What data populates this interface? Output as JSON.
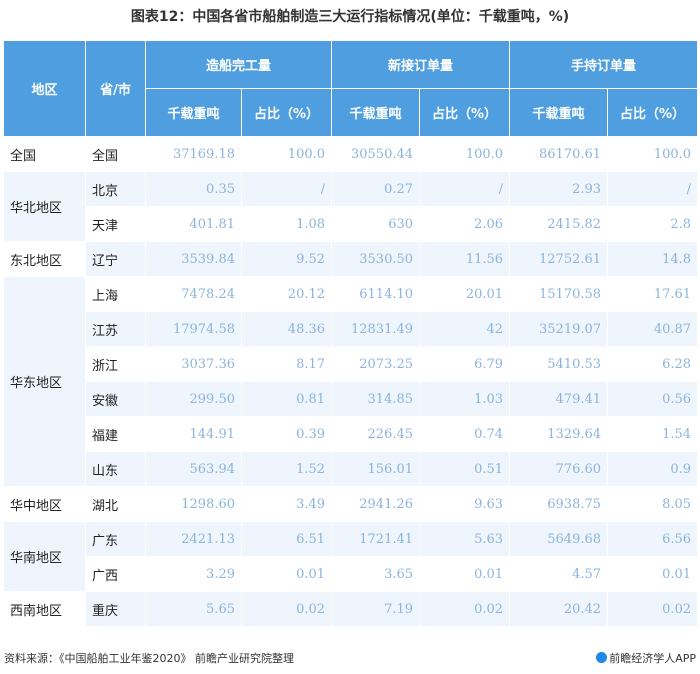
{
  "title": "图表12：中国各省市船舶制造三大运行指标情况(单位：千载重吨，%)",
  "headers": {
    "region": "地区",
    "province": "省/市",
    "groups": [
      "造船完工量",
      "新接订单量",
      "手持订单量"
    ],
    "sub": [
      "千载重吨",
      "占比（%）",
      "千载重吨",
      "占比（%）",
      "千载重吨",
      "占比（%）"
    ]
  },
  "regions": [
    {
      "name": "全国",
      "rows": [
        {
          "prov": "全国",
          "v": [
            "37169.18",
            "100.0",
            "30550.44",
            "100.0",
            "86170.61",
            "100.0"
          ]
        }
      ]
    },
    {
      "name": "华北地区",
      "rows": [
        {
          "prov": "北京",
          "v": [
            "0.35",
            "/",
            "0.27",
            "/",
            "2.93",
            "/"
          ]
        },
        {
          "prov": "天津",
          "v": [
            "401.81",
            "1.08",
            "630",
            "2.06",
            "2415.82",
            "2.8"
          ]
        }
      ]
    },
    {
      "name": "东北地区",
      "rows": [
        {
          "prov": "辽宁",
          "v": [
            "3539.84",
            "9.52",
            "3530.50",
            "11.56",
            "12752.61",
            "14.8"
          ]
        }
      ]
    },
    {
      "name": "华东地区",
      "rows": [
        {
          "prov": "上海",
          "v": [
            "7478.24",
            "20.12",
            "6114.10",
            "20.01",
            "15170.58",
            "17.61"
          ]
        },
        {
          "prov": "江苏",
          "v": [
            "17974.58",
            "48.36",
            "12831.49",
            "42",
            "35219.07",
            "40.87"
          ]
        },
        {
          "prov": "浙江",
          "v": [
            "3037.36",
            "8.17",
            "2073.25",
            "6.79",
            "5410.53",
            "6.28"
          ]
        },
        {
          "prov": "安徽",
          "v": [
            "299.50",
            "0.81",
            "314.85",
            "1.03",
            "479.41",
            "0.56"
          ]
        },
        {
          "prov": "福建",
          "v": [
            "144.91",
            "0.39",
            "226.45",
            "0.74",
            "1329.64",
            "1.54"
          ]
        },
        {
          "prov": "山东",
          "v": [
            "563.94",
            "1.52",
            "156.01",
            "0.51",
            "776.60",
            "0.9"
          ]
        }
      ]
    },
    {
      "name": "华中地区",
      "rows": [
        {
          "prov": "湖北",
          "v": [
            "1298.60",
            "3.49",
            "2941.26",
            "9.63",
            "6938.75",
            "8.05"
          ]
        }
      ]
    },
    {
      "name": "华南地区",
      "rows": [
        {
          "prov": "广东",
          "v": [
            "2421.13",
            "6.51",
            "1721.41",
            "5.63",
            "5649.68",
            "6.56"
          ]
        },
        {
          "prov": "广西",
          "v": [
            "3.29",
            "0.01",
            "3.65",
            "0.01",
            "4.57",
            "0.01"
          ]
        }
      ]
    },
    {
      "name": "西南地区",
      "rows": [
        {
          "prov": "重庆",
          "v": [
            "5.65",
            "0.02",
            "7.19",
            "0.02",
            "20.42",
            "0.02"
          ]
        }
      ]
    }
  ],
  "footer": {
    "source": "资料来源：《中国船舶工业年鉴2020》 前瞻产业研究院整理",
    "brand": "前瞻经济学人APP"
  }
}
